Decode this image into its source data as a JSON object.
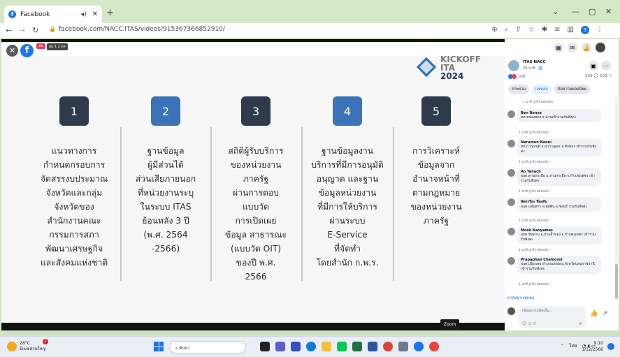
{
  "browser": {
    "tab_title": "Facebook",
    "url": "facebook.com/NACC.ITAS/videos/915367366852910/",
    "profile_initial": "S"
  },
  "video": {
    "live_badge": "สด",
    "viewers_badge": "ผม 1.2 ดล",
    "brand": {
      "line1": "KICKOFF",
      "line2": "ITA",
      "line3": "2024"
    },
    "columns": [
      {
        "num": "1",
        "text": "แนวทางการ\nกำหนดกรอบการ\nจัดสรรงบประมาณ\nจังหวัดและกลุ่ม\nจังหวัดของ\nสำนักงานคณะ\nกรรมการสภา\nพัฒนาเศรษฐกิจ\nและสังคมแห่งชาติ"
      },
      {
        "num": "2",
        "text": "ฐานข้อมูล\nผู้มีส่วนได้\nส่วนเสียภายนอก\nที่หน่วยงานระบุ\nในระบบ ITAS\nย้อนหลัง 3 ปี\n(พ.ศ. 2564\n-2566)"
      },
      {
        "num": "3",
        "text": "สถิติผู้รับบริการ\nของหน่วยงาน\nภาครัฐ\nผ่านการตอบ\nแบบวัด\nการเปิดเผย\nข้อมูล สาธารณะ\n(แบบวัด OIT)\nของปี พ.ศ.\n2566"
      },
      {
        "num": "4",
        "text": "ฐานข้อมูลงาน\nบริการที่มีการอนุมัติ\nอนุญาต และฐาน\nข้อมูลหน่วยงาน\nที่มีการให้บริการ\nผ่านระบบ\nE-Service\nที่จัดทำ\nโดยสำนัก ก.พ.ร."
      },
      {
        "num": "5",
        "text": "การวิเคราะห์\nข้อมูลจาก\nอำนาจหน้าที่\nตามกฎหมาย\nของหน่วยงาน\nภาครัฐ"
      }
    ]
  },
  "sidebar": {
    "page_name": "ITAS NACC",
    "page_time": "29 นาที · 🌐",
    "reactions_count": "106",
    "comment_count": "229",
    "share_count": "103",
    "chips": [
      "ภาพรวม",
      "แชทสด",
      "ข้อความยอดนิยม"
    ],
    "comments": [
      {
        "name": "",
        "text": "",
        "meta": "1 นาที   ถูกใจ   ตอบกลับ"
      },
      {
        "name": "Ben Benya",
        "text": "ทท.ทนองอดง จ.น่านเข้าร่วมรับฟังค่ะ",
        "meta": "1 นาที   ถูกใจ   ตอบกลับ"
      },
      {
        "name": "Narumon Nanui",
        "text": "ทท.กาญจนดิ อ.ม่ากาญจน จ.ทักษอง เข้าร่วมรับฟังค่ะ",
        "meta": "1 นาที   ถูกใจ   ตอบกลับ"
      },
      {
        "name": "Ao Tanach",
        "text": "อบต.ดานกระยือ อ.ลานกระยือ จ.กำแพงเพชร เข้าร่วมรับฟังค่ะ",
        "meta": "1 นาที   ถูกใจ   ตอบกลับ"
      },
      {
        "name": "สัตตารียะ ทีองคัน",
        "text": "อบต.แสนสาร อ.ลัดพิน จ.ชลบุรี ร่วมรับฟังค่ะ",
        "meta": "1 นาที   ถูกใจ   ตอบกลับ"
      },
      {
        "name": "Mook Kanyamas",
        "text": "อบต.ทับดาน อ.ปากล้ำทอง จ.กำแพงเพชร เข้าร่วมรับฟังค่ะ",
        "meta": "1 นาที   ถูกใจ   ตอบกลับ"
      },
      {
        "name": "Prapaphan Chaloosoi",
        "text": "อบต.เมืองเคย อำเภอเฝ่งอ่อน จังหวัดนุลนราชธานี เข้าร่วมรับฟังค่ะ",
        "meta": "1 นาที   ถูกใจ   ตอบกลับ"
      }
    ],
    "more_link": "ผาดทฐานชุมชน",
    "composer_placeholder": "เขียนความคิดเห็น..."
  },
  "tooltip": "Zoom",
  "taskbar": {
    "temp": "28°C",
    "weather": "มีเมฆส่วนใหญ่",
    "search": "ค้นหา",
    "lang": "ไทย",
    "time": "9:10",
    "date": "1/12/2566",
    "notif": "1"
  }
}
